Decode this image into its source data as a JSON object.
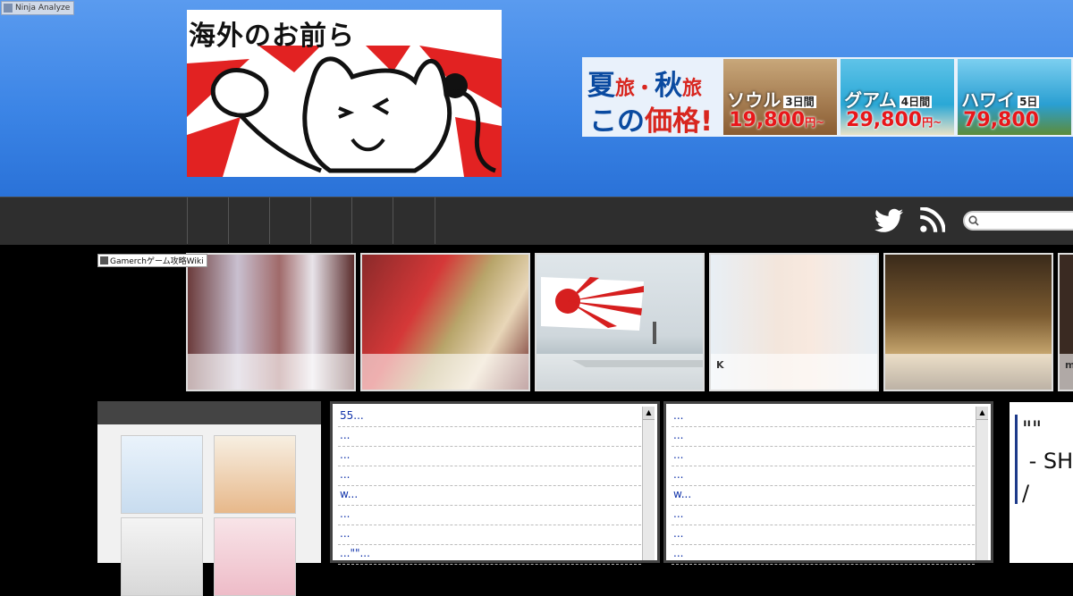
{
  "overlay_tags": {
    "ninja": "Ninja Analyze",
    "gamerch": "Gamerchゲーム攻略Wiki"
  },
  "logo": {
    "text": "海外のお前ら"
  },
  "banner": {
    "line1_a": "夏",
    "line1_b": "旅・",
    "line1_c": "秋",
    "line1_d": "旅",
    "line2_a": "この",
    "line2_b": "価格!",
    "destinations": [
      {
        "name": "ソウル",
        "days": "3日間",
        "price": "19,800",
        "unit": "円~"
      },
      {
        "name": "グアム",
        "days": "4日間",
        "price": "29,800",
        "unit": "円~"
      },
      {
        "name": "ハワイ",
        "days": "5日",
        "price": "79,800",
        "unit": ""
      }
    ]
  },
  "thumbs": [
    {
      "caption": ""
    },
    {
      "caption": ""
    },
    {
      "caption": ""
    },
    {
      "caption": "K"
    },
    {
      "caption": ""
    },
    {
      "caption": "m"
    }
  ],
  "feed_left": [
    "55...",
    " ...",
    "...",
    " ...",
    "w...",
    "...",
    " ...",
    "...\"\"..."
  ],
  "feed_right": [
    "...",
    " ...",
    " ...",
    " ...",
    "w...",
    " ...",
    " ...",
    " ..."
  ],
  "quote": {
    "text": "\"\"\n - SH\n/"
  }
}
